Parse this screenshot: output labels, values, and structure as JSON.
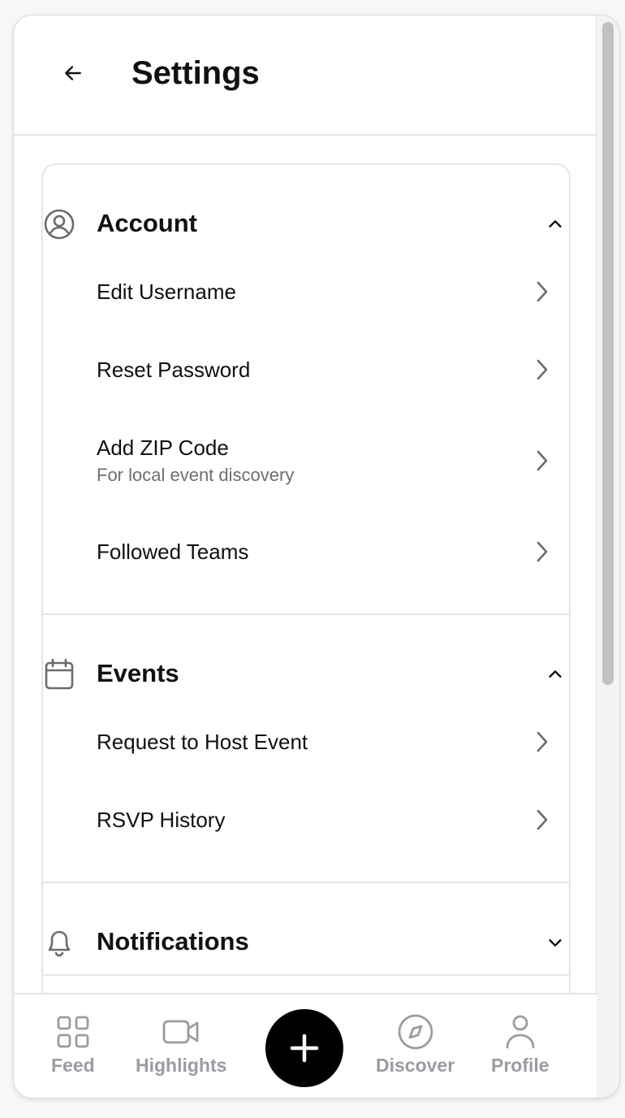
{
  "header": {
    "title": "Settings"
  },
  "sections": {
    "account": {
      "title": "Account",
      "items": [
        {
          "label": "Edit Username"
        },
        {
          "label": "Reset Password"
        },
        {
          "label": "Add ZIP Code",
          "sublabel": "For local event discovery"
        },
        {
          "label": "Followed Teams"
        }
      ]
    },
    "events": {
      "title": "Events",
      "items": [
        {
          "label": "Request to Host Event"
        },
        {
          "label": "RSVP History"
        }
      ]
    },
    "notifications": {
      "title": "Notifications"
    }
  },
  "tabbar": {
    "feed": "Feed",
    "highlights": "Highlights",
    "discover": "Discover",
    "profile": "Profile"
  },
  "icons": {
    "back": "arrow-left-icon",
    "account": "user-circle-icon",
    "events": "calendar-icon",
    "notifications": "bell-icon",
    "collapse": "chevron-up-icon",
    "expand": "chevron-down-icon",
    "row": "chevron-right-icon",
    "feed": "grid-icon",
    "highlights": "video-camera-icon",
    "add": "plus-icon",
    "discover": "compass-icon",
    "profile": "person-icon"
  }
}
